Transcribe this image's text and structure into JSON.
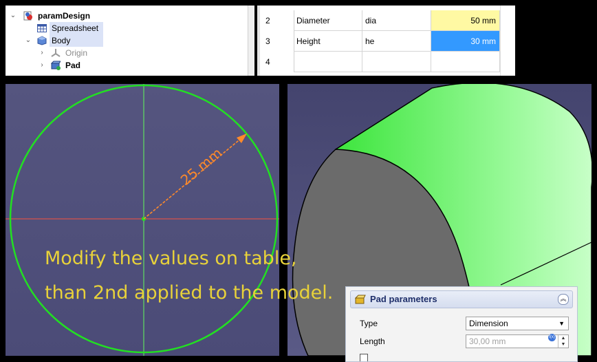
{
  "tree": {
    "items": [
      {
        "label": "paramDesign",
        "bold": true
      },
      {
        "label": "Spreadsheet"
      },
      {
        "label": "Body"
      },
      {
        "label": "Origin"
      },
      {
        "label": "Pad",
        "bold": true
      }
    ]
  },
  "sheet": {
    "rows": [
      {
        "num": "2",
        "a": "Diameter",
        "b": "dia",
        "c": "50 mm"
      },
      {
        "num": "3",
        "a": "Height",
        "b": "he",
        "c": "30 mm"
      },
      {
        "num": "4",
        "a": "",
        "b": "",
        "c": ""
      }
    ],
    "colors": {
      "yellow": "#fff9a3",
      "selected": "#3399ff"
    }
  },
  "sketch": {
    "dimension": "25 mm"
  },
  "caption": {
    "line1": "Modify the values on table,",
    "line2": "than 2nd applied to the model."
  },
  "pad": {
    "title": "Pad parameters",
    "type_label": "Type",
    "type_value": "Dimension",
    "length_label": "Length",
    "length_value": "30,00 mm"
  }
}
